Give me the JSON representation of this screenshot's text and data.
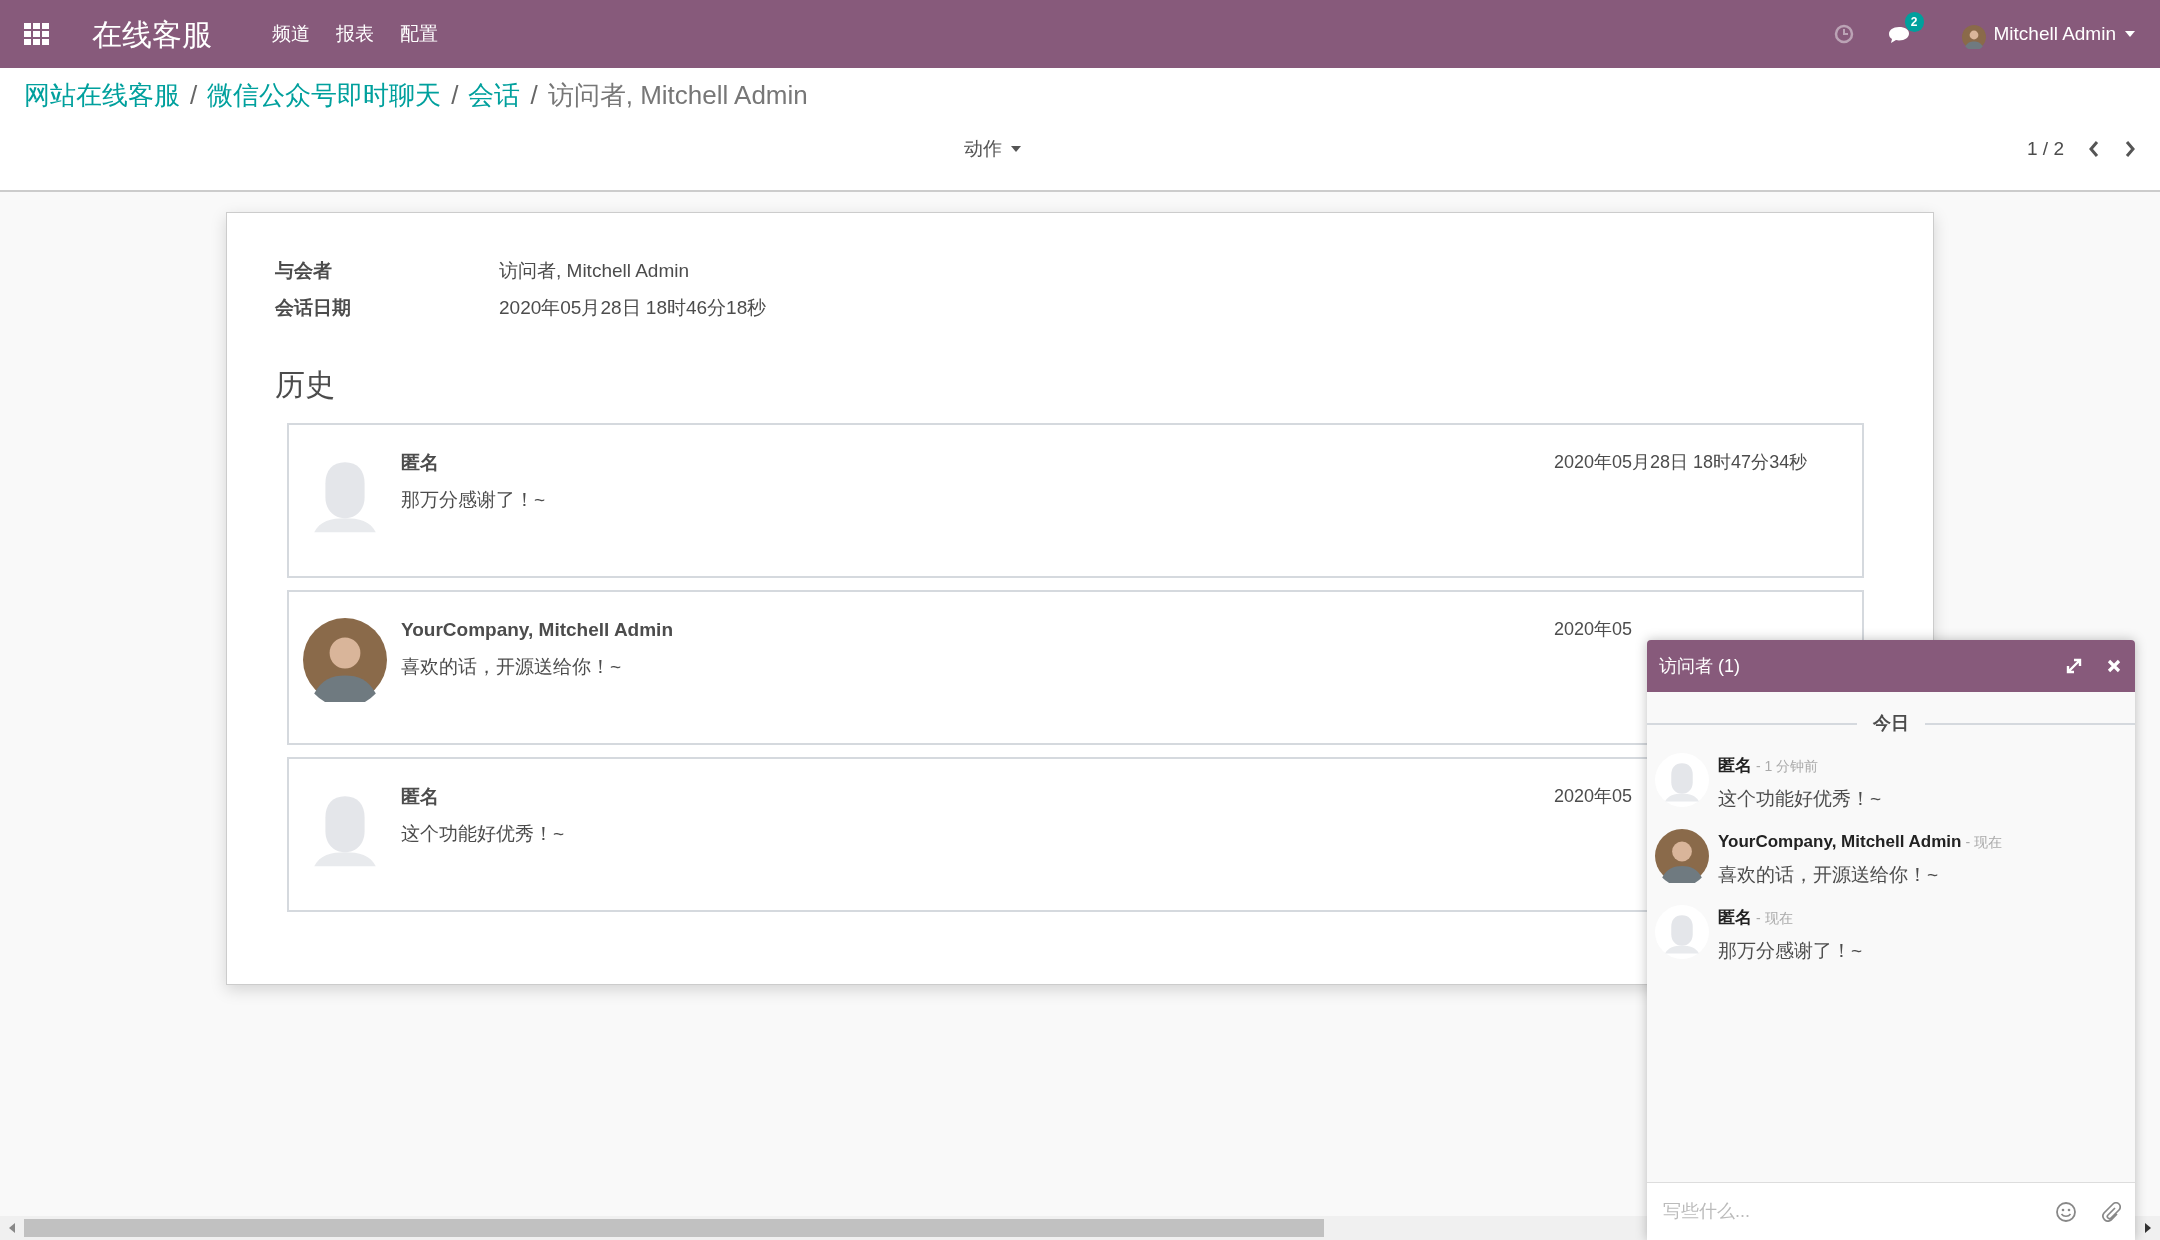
{
  "navbar": {
    "app_title": "在线客服",
    "menu": [
      "频道",
      "报表",
      "配置"
    ],
    "messaging_count": "2",
    "user": "Mitchell Admin"
  },
  "breadcrumb": [
    {
      "label": "网站在线客服",
      "link": true
    },
    {
      "separator": "/",
      "label": "微信公众号即时聊天",
      "link": true
    },
    {
      "separator": "/",
      "label": "会话",
      "link": true
    },
    {
      "separator": "/",
      "label": "访问者, Mitchell Admin",
      "link": false
    }
  ],
  "action_button": "动作",
  "pager": "1 / 2",
  "fields": [
    {
      "label": "与会者",
      "value": "访问者, Mitchell Admin"
    },
    {
      "label": "会话日期",
      "value": "2020年05月28日 18时46分18秒"
    }
  ],
  "history_title": "历史",
  "history": [
    {
      "author": "匿名",
      "kind": "anonymous",
      "body": "那万分感谢了！~",
      "date": "2020年05月28日 18时47分34秒"
    },
    {
      "author": "YourCompany, Mitchell Admin",
      "kind": "photo",
      "body": "喜欢的话，开源送给你！~",
      "date": "2020年05"
    },
    {
      "author": "匿名",
      "kind": "anonymous",
      "body": "这个功能好优秀！~",
      "date": "2020年05"
    }
  ],
  "chat": {
    "title": "访问者 (1)",
    "day": "今日",
    "messages": [
      {
        "author": "匿名",
        "kind": "anonymous",
        "time": "- 1 分钟前",
        "body": "这个功能好优秀！~"
      },
      {
        "author": "YourCompany, Mitchell Admin",
        "kind": "photo",
        "time": "- 现在",
        "body": "喜欢的话，开源送给你！~"
      },
      {
        "author": "匿名",
        "kind": "anonymous",
        "time": "- 现在",
        "body": "那万分感谢了！~"
      }
    ],
    "composer": {
      "placeholder": "写些什么..."
    }
  }
}
